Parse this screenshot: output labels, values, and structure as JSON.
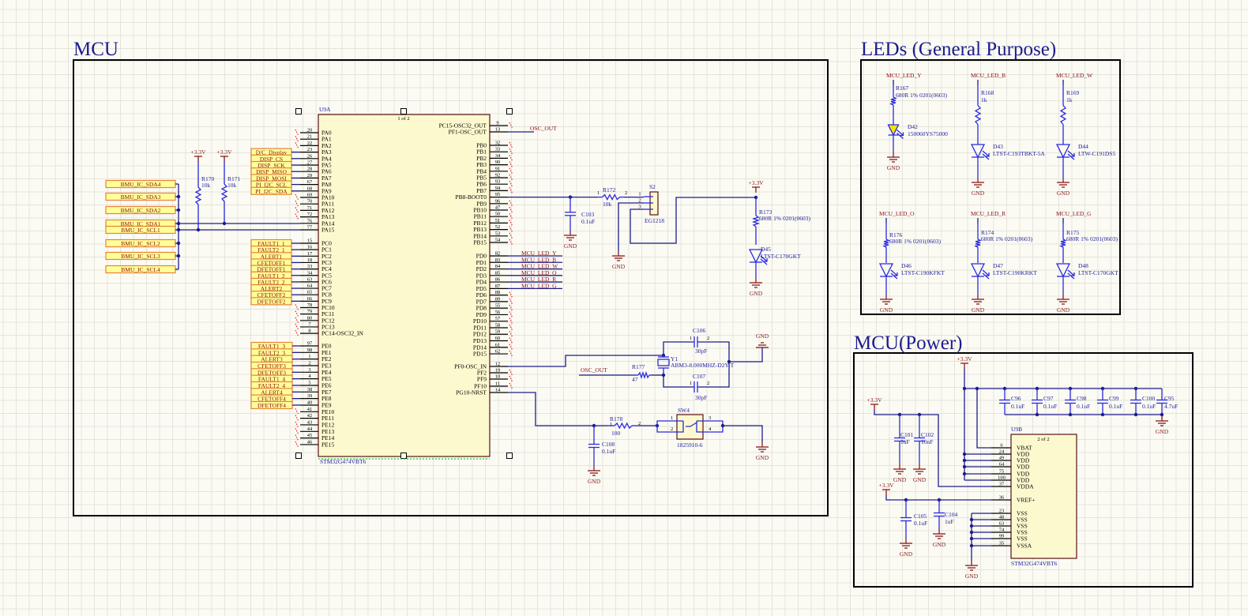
{
  "sections": {
    "mcu": "MCU",
    "leds": "LEDs (General Purpose)",
    "power": "MCU(Power)"
  },
  "colors": {
    "wire": "#1c1c8e",
    "component": "#2a2ae0",
    "power": "#8b1a1a",
    "chip_fill": "#fdf9cf",
    "net_label_fill": "#ffff99",
    "net_label_border": "#e8823c",
    "unconnected": "#ee0000"
  },
  "nets": {
    "vcc": "+3.3V",
    "gnd": "GND",
    "osc_out": "OSC_OUT"
  },
  "u9a": {
    "designator": "U9A",
    "part_of": "1 of 2",
    "part": "STM32G474VBT6",
    "pa": [
      {
        "n": "PA0",
        "p": "20"
      },
      {
        "n": "PA1",
        "p": "21"
      },
      {
        "n": "PA2",
        "p": "22"
      },
      {
        "n": "PA3",
        "p": "23"
      },
      {
        "n": "PA4",
        "p": "26"
      },
      {
        "n": "PA5",
        "p": "27"
      },
      {
        "n": "PA6",
        "p": "28"
      },
      {
        "n": "PA7",
        "p": "29"
      },
      {
        "n": "PA8",
        "p": "67"
      },
      {
        "n": "PA9",
        "p": "68"
      },
      {
        "n": "PA10",
        "p": "69"
      },
      {
        "n": "PA11",
        "p": "70"
      },
      {
        "n": "PA12",
        "p": "71"
      },
      {
        "n": "PA13",
        "p": "72"
      },
      {
        "n": "PA14",
        "p": "76"
      },
      {
        "n": "PA15",
        "p": "77"
      }
    ],
    "pc": [
      {
        "n": "PC0",
        "p": "15"
      },
      {
        "n": "PC1",
        "p": "16"
      },
      {
        "n": "PC2",
        "p": "17"
      },
      {
        "n": "PC3",
        "p": "18"
      },
      {
        "n": "PC4",
        "p": "33"
      },
      {
        "n": "PC5",
        "p": "34"
      },
      {
        "n": "PC6",
        "p": "63"
      },
      {
        "n": "PC7",
        "p": "64"
      },
      {
        "n": "PC8",
        "p": "65"
      },
      {
        "n": "PC9",
        "p": "66"
      },
      {
        "n": "PC10",
        "p": "78"
      },
      {
        "n": "PC11",
        "p": "79"
      },
      {
        "n": "PC12",
        "p": "80"
      },
      {
        "n": "PC13",
        "p": "7"
      },
      {
        "n": "PC14-OSC32_IN",
        "p": "8"
      }
    ],
    "pe": [
      {
        "n": "PE0",
        "p": "97"
      },
      {
        "n": "PE1",
        "p": "98"
      },
      {
        "n": "PE2",
        "p": "1"
      },
      {
        "n": "PE3",
        "p": "2"
      },
      {
        "n": "PE4",
        "p": "3"
      },
      {
        "n": "PE5",
        "p": "4"
      },
      {
        "n": "PE6",
        "p": "5"
      },
      {
        "n": "PE7",
        "p": "38"
      },
      {
        "n": "PE8",
        "p": "39"
      },
      {
        "n": "PE9",
        "p": "40"
      },
      {
        "n": "PE10",
        "p": "41"
      },
      {
        "n": "PE11",
        "p": "42"
      },
      {
        "n": "PE12",
        "p": "43"
      },
      {
        "n": "PE13",
        "p": "44"
      },
      {
        "n": "PE14",
        "p": "45"
      },
      {
        "n": "PE15",
        "p": "46"
      }
    ],
    "osc": [
      {
        "n": "PC15-OSC32_OUT",
        "p": "9"
      },
      {
        "n": "PF1-OSC_OUT",
        "p": "13"
      }
    ],
    "pb": [
      {
        "n": "PB0",
        "p": "32"
      },
      {
        "n": "PB1",
        "p": "33"
      },
      {
        "n": "PB2",
        "p": "34"
      },
      {
        "n": "PB3",
        "p": "90"
      },
      {
        "n": "PB4",
        "p": "91"
      },
      {
        "n": "PB5",
        "p": "92"
      },
      {
        "n": "PB6",
        "p": "93"
      },
      {
        "n": "PB7",
        "p": "94"
      },
      {
        "n": "PB8-BOOT0",
        "p": "95"
      },
      {
        "n": "PB9",
        "p": "96"
      },
      {
        "n": "PB10",
        "p": "47"
      },
      {
        "n": "PB11",
        "p": "50"
      },
      {
        "n": "PB12",
        "p": "51"
      },
      {
        "n": "PB13",
        "p": "52"
      },
      {
        "n": "PB14",
        "p": "53"
      },
      {
        "n": "PB15",
        "p": "54"
      }
    ],
    "pd": [
      {
        "n": "PD0",
        "p": "82"
      },
      {
        "n": "PD1",
        "p": "83"
      },
      {
        "n": "PD2",
        "p": "84"
      },
      {
        "n": "PD3",
        "p": "85"
      },
      {
        "n": "PD4",
        "p": "86"
      },
      {
        "n": "PD5",
        "p": "87"
      },
      {
        "n": "PD6",
        "p": "88"
      },
      {
        "n": "PD7",
        "p": "89"
      },
      {
        "n": "PD8",
        "p": "55"
      },
      {
        "n": "PD9",
        "p": "56"
      },
      {
        "n": "PD10",
        "p": "57"
      },
      {
        "n": "PD11",
        "p": "58"
      },
      {
        "n": "PD12",
        "p": "59"
      },
      {
        "n": "PD13",
        "p": "60"
      },
      {
        "n": "PD14",
        "p": "61"
      },
      {
        "n": "PD15",
        "p": "62"
      }
    ],
    "pf": [
      {
        "n": "PF0-OSC_IN",
        "p": "12"
      },
      {
        "n": "PF2",
        "p": "19"
      },
      {
        "n": "PF9",
        "p": "10"
      },
      {
        "n": "PF10",
        "p": "11"
      },
      {
        "n": "PG10-NRST",
        "p": "14"
      }
    ]
  },
  "net_labels": {
    "pa": [
      "D/C_Display",
      "DISP_CS",
      "DISP_SCK",
      "DISP_MISO",
      "DISP_MOSI",
      "PI_I2C_SCL",
      "PI_I2C_SDA"
    ],
    "pc": [
      "FAULT1_1",
      "FAULT2_1",
      "ALERT1",
      "CFETOFF1",
      "DFETOFF1",
      "FAULT1_2",
      "FAULT2_2",
      "ALERT2",
      "CFETOFF2",
      "DFETOFF2"
    ],
    "pe": [
      "FAULT1_3",
      "FAULT2_3",
      "ALERT3",
      "CFETOFF3",
      "DFETOFF3",
      "FAULT1_4",
      "FAULT2_4",
      "ALERT4",
      "CFETOFF4",
      "DFETOFF4"
    ],
    "bmu": [
      "BMU_IC_SDA4",
      "BMU_IC_SDA3",
      "BMU_IC_SDA2",
      "BMU_IC_SDA1",
      "BMU_IC_SCL1",
      "BMU_IC_SCL2",
      "BMU_IC_SCL3",
      "BMU_IC_SCL4"
    ],
    "pd": [
      "MCU_LED_Y",
      "MCU_LED_B",
      "MCU_LED_W",
      "MCU_LED_O",
      "MCU_LED_R",
      "MCU_LED_G"
    ]
  },
  "components": {
    "r170": {
      "ref": "R170",
      "value": "10k"
    },
    "r171": {
      "ref": "R171",
      "value": "10k"
    },
    "r172": {
      "ref": "R172",
      "value": "10k",
      "pins": [
        "1",
        "2"
      ]
    },
    "c103": {
      "ref": "C103",
      "value": "0.1uF"
    },
    "s2": {
      "ref": "S2",
      "value": "EG1218",
      "pins": [
        "1",
        "2",
        "3"
      ]
    },
    "r173": {
      "ref": "R173",
      "value": "680R 1% 0201(0603)"
    },
    "d45": {
      "ref": "D45",
      "value": "LTST-C170GKT"
    },
    "y1": {
      "ref": "Y1",
      "value": "ABM3-8.000MHZ-D2Y-T"
    },
    "c106": {
      "ref": "C106",
      "value": "30pF",
      "pins": [
        "1",
        "2"
      ]
    },
    "c107": {
      "ref": "C107",
      "value": "30pF",
      "pins": [
        "1",
        "2"
      ]
    },
    "r177": {
      "ref": "R177",
      "value": "47"
    },
    "r178": {
      "ref": "R178",
      "value": "100",
      "pins": [
        "1",
        "2"
      ]
    },
    "sw4": {
      "ref": "SW4",
      "value": "1825910-6",
      "pins": [
        "1",
        "2",
        "3",
        "4"
      ]
    },
    "c108": {
      "ref": "C108",
      "value": "0.1uF"
    }
  },
  "leds": [
    {
      "net": "MCU_LED_Y",
      "r_ref": "R167",
      "r_val": "680R 1% 0201(0603)",
      "d_ref": "D42",
      "d_val": "150060YS75000",
      "color": "#f5e400"
    },
    {
      "net": "MCU_LED_B",
      "r_ref": "R168",
      "r_val": "1k",
      "d_ref": "D43",
      "d_val": "LTST-C193TBKT-5A"
    },
    {
      "net": "MCU_LED_W",
      "r_ref": "R169",
      "r_val": "1k",
      "d_ref": "D44",
      "d_val": "LTW-C191DS5"
    },
    {
      "net": "MCU_LED_O",
      "r_ref": "R176",
      "r_val": "680R 1% 0201(0603)",
      "d_ref": "D46",
      "d_val": "LTST-C190KFKT"
    },
    {
      "net": "MCU_LED_R",
      "r_ref": "R174",
      "r_val": "680R 1% 0201(0603)",
      "d_ref": "D47",
      "d_val": "LTST-C190KRKT"
    },
    {
      "net": "MCU_LED_G",
      "r_ref": "R175",
      "r_val": "680R 1% 0201(0603)",
      "d_ref": "D48",
      "d_val": "LTST-C170GKT"
    }
  ],
  "power": {
    "u9b": {
      "designator": "U9B",
      "part_of": "2 of 2",
      "part": "STM32G474VBT6",
      "pins": [
        {
          "n": "VBAT",
          "p": "6"
        },
        {
          "n": "VDD",
          "p": "24"
        },
        {
          "n": "VDD",
          "p": "49"
        },
        {
          "n": "VDD",
          "p": "64"
        },
        {
          "n": "VDD",
          "p": "75"
        },
        {
          "n": "VDD",
          "p": "100"
        },
        {
          "n": "VDDA",
          "p": "37"
        },
        {
          "n": "VREF+",
          "p": "36"
        },
        {
          "n": "VSS",
          "p": "23"
        },
        {
          "n": "VSS",
          "p": "48"
        },
        {
          "n": "VSS",
          "p": "63"
        },
        {
          "n": "VSS",
          "p": "74"
        },
        {
          "n": "VSS",
          "p": "99"
        },
        {
          "n": "VSSA",
          "p": "35"
        }
      ]
    },
    "decoupling": [
      {
        "ref": "C96",
        "value": "0.1uF"
      },
      {
        "ref": "C97",
        "value": "0.1uF"
      },
      {
        "ref": "C98",
        "value": "0.1uF"
      },
      {
        "ref": "C99",
        "value": "0.1uF"
      },
      {
        "ref": "C100",
        "value": "0.1uF"
      },
      {
        "ref": "C95",
        "value": "4.7uF"
      }
    ],
    "c101": {
      "ref": "C101",
      "value": "1uF"
    },
    "c102": {
      "ref": "C102",
      "value": "10nF"
    },
    "c105": {
      "ref": "C105",
      "value": "0.1uF"
    },
    "c104": {
      "ref": "C104",
      "value": "1uF"
    }
  }
}
